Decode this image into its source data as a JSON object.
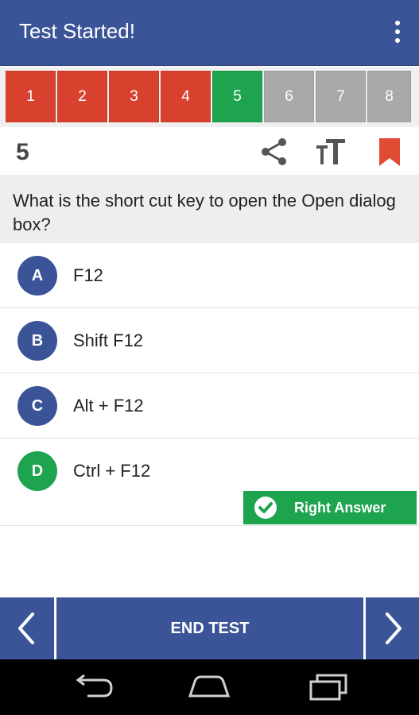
{
  "header": {
    "title": "Test Started!",
    "menu_icon": "overflow-menu-icon"
  },
  "question_nav": {
    "items": [
      {
        "label": "1",
        "status": "answered-wrong"
      },
      {
        "label": "2",
        "status": "answered-wrong"
      },
      {
        "label": "3",
        "status": "answered-wrong"
      },
      {
        "label": "4",
        "status": "answered-wrong"
      },
      {
        "label": "5",
        "status": "answered-right"
      },
      {
        "label": "6",
        "status": "unanswered"
      },
      {
        "label": "7",
        "status": "unanswered"
      },
      {
        "label": "8",
        "status": "unanswered"
      }
    ]
  },
  "toolbar": {
    "question_number": "5",
    "share_icon": "share-icon",
    "text_size_icon": "text-size-icon",
    "bookmark_icon": "bookmark-icon"
  },
  "question": {
    "text": "What is the short cut key to open the Open dialog box?"
  },
  "options": [
    {
      "letter": "A",
      "text": "F12"
    },
    {
      "letter": "B",
      "text": "Shift F12"
    },
    {
      "letter": "C",
      "text": "Alt + F12"
    },
    {
      "letter": "D",
      "text": "Ctrl + F12"
    }
  ],
  "result": {
    "label": "Right Answer",
    "icon": "check-circle-icon"
  },
  "footer": {
    "end_test_label": "END TEST",
    "prev_icon": "chevron-left-icon",
    "next_icon": "chevron-right-icon"
  },
  "colors": {
    "primary": "#3b5497",
    "wrong": "#d9412f",
    "right": "#1ea34f",
    "unanswered": "#a9a9a9",
    "bookmark": "#e14a33"
  }
}
